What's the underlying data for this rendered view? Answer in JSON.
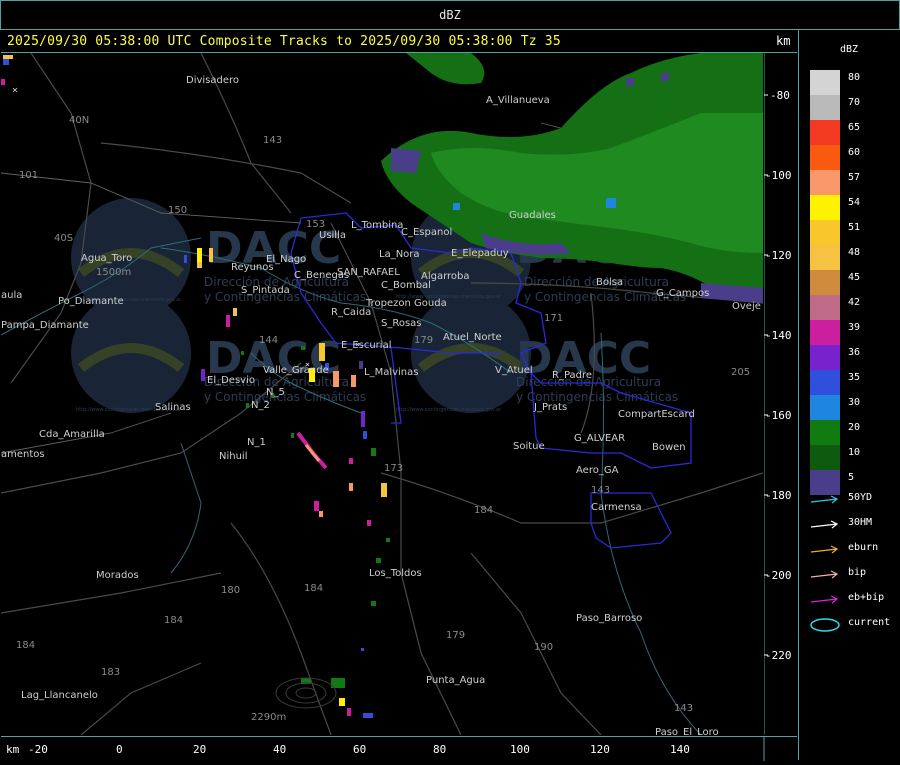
{
  "header": {
    "title": "dBZ"
  },
  "info": {
    "text": "2025/09/30 05:38:00 UTC Composite Tracks to 2025/09/30 05:38:00 Tz 35",
    "km_label": "km"
  },
  "legend": {
    "title": "dBZ",
    "scale": [
      {
        "value": "80",
        "color": "#d4d4d4"
      },
      {
        "value": "70",
        "color": "#b9b9b9"
      },
      {
        "value": "65",
        "color": "#f23a22"
      },
      {
        "value": "60",
        "color": "#f85a10"
      },
      {
        "value": "57",
        "color": "#f8986a"
      },
      {
        "value": "54",
        "color": "#fff200"
      },
      {
        "value": "51",
        "color": "#f8c72a"
      },
      {
        "value": "48",
        "color": "#f5c242"
      },
      {
        "value": "45",
        "color": "#d08b3c"
      },
      {
        "value": "42",
        "color": "#c06a8a"
      },
      {
        "value": "39",
        "color": "#cc1fa0"
      },
      {
        "value": "36",
        "color": "#7722cc"
      },
      {
        "value": "35",
        "color": "#2f4fdc"
      },
      {
        "value": "30",
        "color": "#1f86e0"
      },
      {
        "value": "20",
        "color": "#117a11"
      },
      {
        "value": "10",
        "color": "#0e5a0e"
      },
      {
        "value": "5",
        "color": "#4a3d8a"
      }
    ],
    "tracks": [
      {
        "label": "50YD",
        "color": "#22d0e8"
      },
      {
        "label": "30HM",
        "color": "#ffffff"
      },
      {
        "label": "eburn",
        "color": "#f0b030"
      },
      {
        "label": "bip",
        "color": "#f0b0b0"
      },
      {
        "label": "eb+bip",
        "color": "#e020e0"
      },
      {
        "label": "current",
        "color": "#22e0f0"
      }
    ]
  },
  "axes": {
    "x_unit": "km",
    "x_ticks": [
      "-20",
      "0",
      "20",
      "40",
      "60",
      "80",
      "100",
      "120",
      "140"
    ],
    "y_ticks": [
      "-80",
      "-100",
      "-120",
      "-140",
      "-160",
      "-180",
      "-200",
      "-220"
    ]
  },
  "places": [
    "Divisadero",
    "A_Villanueva",
    "Usilla",
    "L_Tombina",
    "C_Espanol",
    "La_Nora",
    "E_Elepaduy",
    "Guadales",
    "Agua_Toro",
    "Reyunos",
    "C_Benegas",
    "SAN_RAFAEL",
    "Algarroba",
    "C_Bombal",
    "Bolsa",
    "G_Campos",
    "Oveje",
    "S_Pintada",
    "Tropezon Gouda",
    "R_Caida",
    "S_Rosas",
    "Atuel_Norte",
    "E_Escurial",
    "Pampa_Diamante",
    "Valle_Grande",
    "L_Malvinas",
    "V_Atuel",
    "R_Padre",
    "El_Desvio",
    "Salinas",
    "N_2",
    "N_5",
    "N_1",
    "J_Prats",
    "CompartEscard",
    "Cda_Amarilla",
    "Nihuil",
    "G_ALVEAR",
    "Bowen",
    "Soitue",
    "Aero_GA",
    "Carmensa",
    "Los_Toldos",
    "Morados",
    "Paso_Barroso",
    "Punta_Agua",
    "Lag_Llancanelo",
    "Paso_El_Loro",
    "amentos",
    "aula",
    "Po_Diamante",
    "El_Nago"
  ],
  "watermark": {
    "brand": "DACC",
    "line1": "Dirección de Agricultura",
    "line2": "y Contingencias Climáticas",
    "url": "http://www.contingencias.mendoza.gov.ar"
  },
  "route_numbers": [
    "143",
    "150",
    "40N",
    "101",
    "153",
    "144",
    "171",
    "173",
    "184",
    "179",
    "190",
    "180",
    "183",
    "205",
    "40S",
    "143"
  ],
  "elevations": [
    "1500m",
    "2290m"
  ]
}
